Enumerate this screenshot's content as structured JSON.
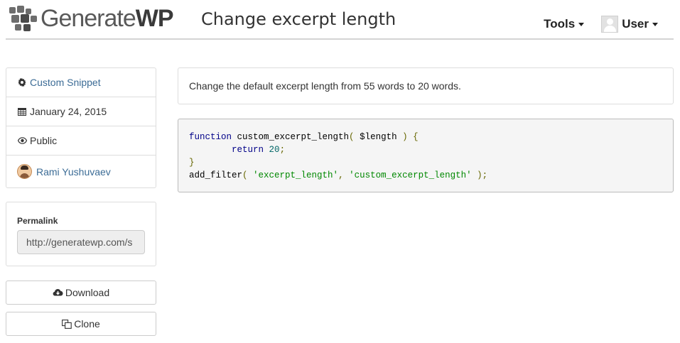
{
  "header": {
    "logo_text_light": "Generate",
    "logo_text_bold": "WP",
    "page_title": "Change excerpt length",
    "nav": {
      "tools_label": "Tools",
      "user_label": "User"
    }
  },
  "sidebar": {
    "meta": {
      "type_label": "Custom Snippet",
      "date": "January 24, 2015",
      "visibility": "Public",
      "author": "Rami Yushuvaev"
    },
    "permalink": {
      "label": "Permalink",
      "value": "http://generatewp.com/s"
    },
    "buttons": {
      "download_label": "Download",
      "clone_label": "Clone"
    }
  },
  "main": {
    "description": "Change the default excerpt length from 55 words to 20 words.",
    "code": {
      "line1_func": "function",
      "line1_name": " custom_excerpt_length",
      "line1_open": "(",
      "line1_param": " $length ",
      "line1_close": ") {",
      "line2_indent": "        ",
      "line2_return": "return",
      "line2_sp": " ",
      "line2_num": "20",
      "line2_semi": ";",
      "line3_brace": "}",
      "line4_call": "add_filter",
      "line4_open": "( ",
      "line4_arg1": "'excerpt_length'",
      "line4_comma": ", ",
      "line4_arg2": "'custom_excerpt_length'",
      "line4_close": " );"
    }
  },
  "colors": {
    "link": "#3c6c96",
    "code_bg": "#f5f5f5",
    "keyword": "#000088",
    "string": "#008800"
  }
}
